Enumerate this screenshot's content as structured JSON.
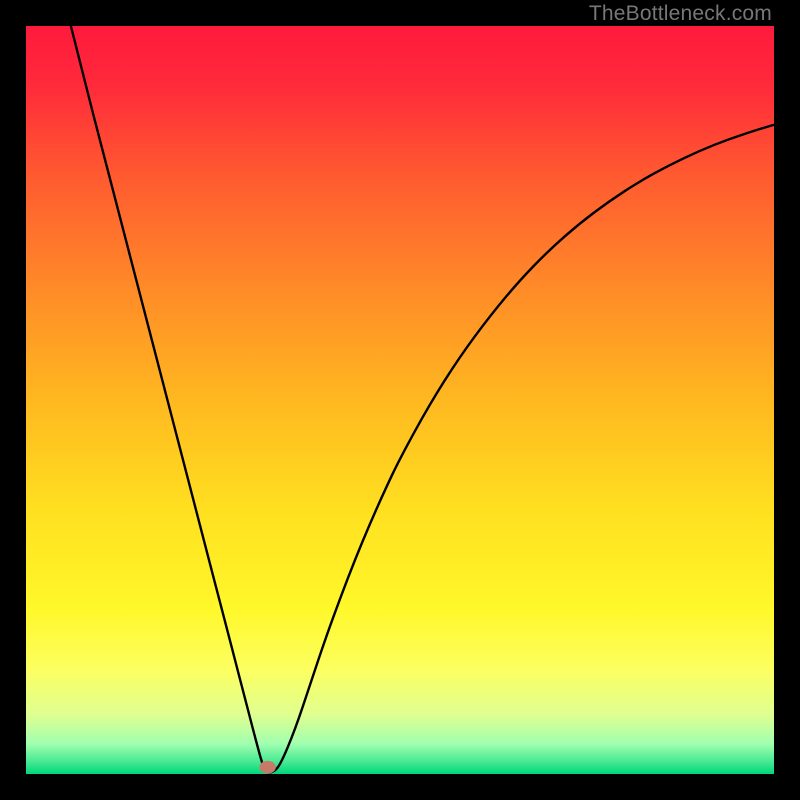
{
  "watermark": "TheBottleneck.com",
  "chart_data": {
    "type": "line",
    "title": "",
    "xlabel": "",
    "ylabel": "",
    "xlim": [
      0,
      100
    ],
    "ylim": [
      0,
      100
    ],
    "grid": false,
    "legend": false,
    "background_gradient": {
      "stops": [
        {
          "pos": 0.0,
          "color": "#ff1a3d"
        },
        {
          "pos": 0.08,
          "color": "#ff2a3a"
        },
        {
          "pos": 0.2,
          "color": "#ff5a30"
        },
        {
          "pos": 0.35,
          "color": "#ff8a28"
        },
        {
          "pos": 0.5,
          "color": "#ffb820"
        },
        {
          "pos": 0.65,
          "color": "#ffe020"
        },
        {
          "pos": 0.78,
          "color": "#fff82a"
        },
        {
          "pos": 0.86,
          "color": "#fcff60"
        },
        {
          "pos": 0.92,
          "color": "#e0ff90"
        },
        {
          "pos": 0.96,
          "color": "#a0ffb0"
        },
        {
          "pos": 0.985,
          "color": "#40e890"
        },
        {
          "pos": 1.0,
          "color": "#00d67a"
        }
      ]
    },
    "series": [
      {
        "name": "bottleneck-curve",
        "color": "#000000",
        "width": 2.4,
        "x": [
          6,
          8,
          10,
          12,
          14,
          16,
          18,
          20,
          22,
          24,
          26,
          27,
          28,
          29,
          30,
          30.5,
          31,
          31.5,
          32,
          33,
          34,
          36,
          38,
          40,
          42,
          44,
          46,
          48,
          50,
          54,
          58,
          62,
          66,
          70,
          74,
          78,
          82,
          86,
          90,
          94,
          98,
          100
        ],
        "y": [
          100,
          92,
          84.3,
          76.6,
          68.9,
          61.2,
          53.5,
          45.8,
          38.1,
          30.4,
          22.7,
          18.9,
          15.0,
          11.2,
          7.3,
          5.4,
          3.5,
          1.7,
          0.2,
          0.2,
          1.2,
          6.0,
          12.0,
          18.0,
          23.5,
          28.7,
          33.5,
          38.0,
          42.2,
          49.5,
          55.8,
          61.2,
          66.0,
          70.1,
          73.6,
          76.6,
          79.2,
          81.4,
          83.3,
          84.9,
          86.2,
          86.8
        ]
      }
    ],
    "marker": {
      "name": "optimal-point",
      "x": 32.3,
      "y": 0.9,
      "rx": 1.1,
      "ry": 0.85,
      "color": "#c77a6a"
    }
  }
}
